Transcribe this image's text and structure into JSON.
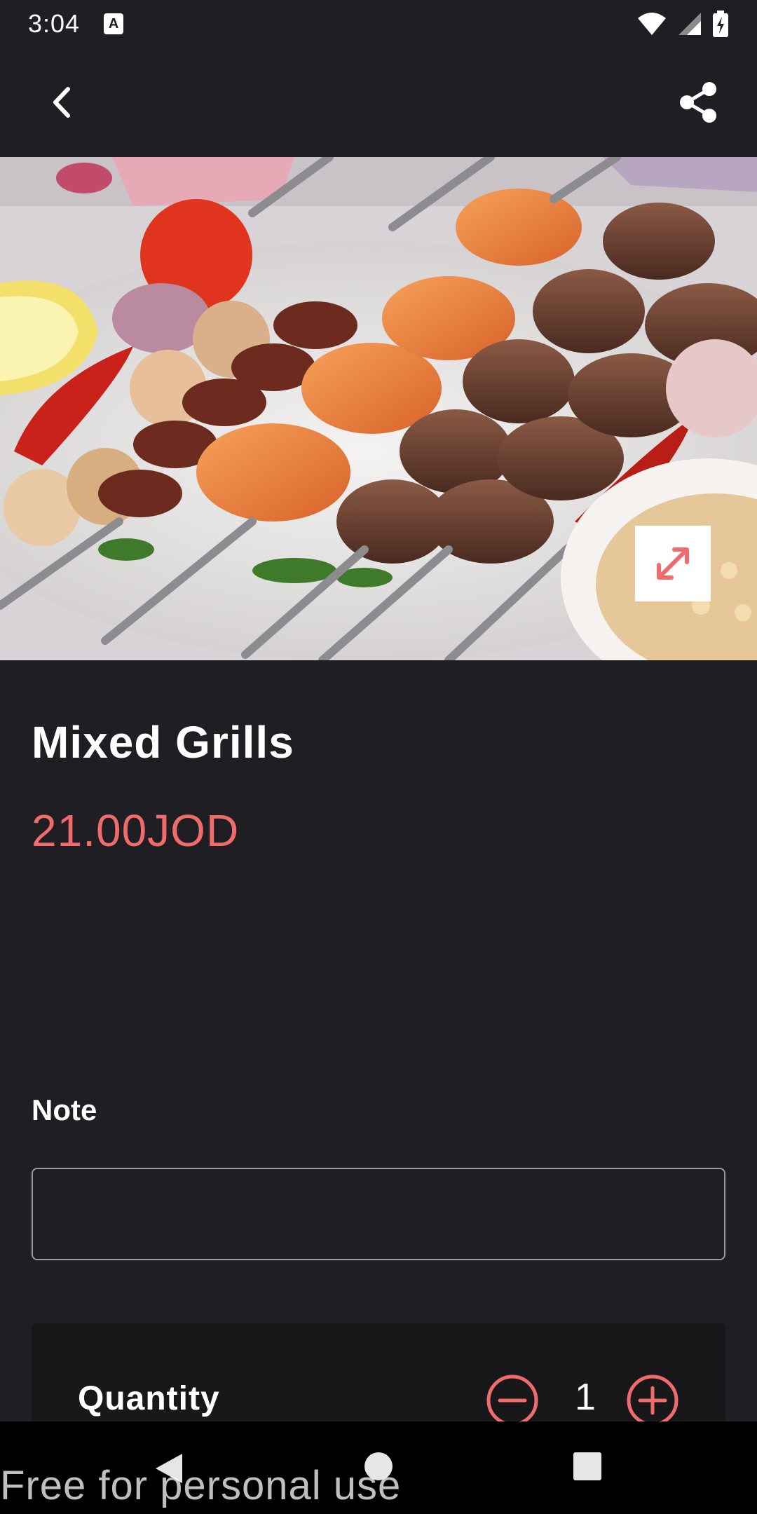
{
  "status_bar": {
    "time": "3:04",
    "notification_badge": "A",
    "icons": [
      "wifi-icon",
      "signal-icon",
      "battery-charging-icon"
    ]
  },
  "app_bar": {
    "back_icon": "chevron-left-icon",
    "share_icon": "share-icon"
  },
  "hero": {
    "image_description_icon": "mixed-grill-skewers-photo",
    "expand_icon": "expand-arrows-icon",
    "accent_color": "#f06b6b"
  },
  "item": {
    "title": "Mixed Grills",
    "price": "21.00JOD",
    "price_color": "#f06b6b"
  },
  "note": {
    "label": "Note",
    "value": "",
    "placeholder": ""
  },
  "quantity": {
    "label": "Quantity",
    "value": "1",
    "minus_icon": "minus-circle-icon",
    "plus_icon": "plus-circle-icon"
  },
  "nav_bar": {
    "icons": [
      "nav-back-icon",
      "nav-home-icon",
      "nav-recents-icon"
    ]
  },
  "watermark": "Free for personal use"
}
